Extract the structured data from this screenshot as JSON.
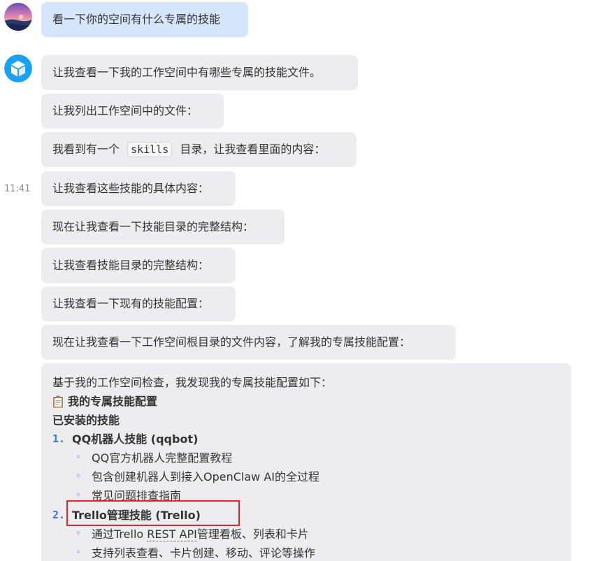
{
  "conversation": {
    "user_message": "看一下你的空间有什么专属的技能",
    "timestamp": "11:41",
    "bot_messages": [
      {
        "text": "让我查看一下我的工作空间中有哪些专属的技能文件。"
      },
      {
        "text": "让我列出工作空间中的文件："
      },
      {
        "before": "我看到有一个",
        "code": "skills",
        "after": "目录，让我查看里面的内容："
      },
      {
        "text": "让我查看这些技能的具体内容："
      },
      {
        "text": "现在让我查看一下技能目录的完整结构："
      },
      {
        "text": "让我查看技能目录的完整结构："
      },
      {
        "text": "让我查看一下现有的技能配置："
      },
      {
        "text": "现在让我查看一下工作空间根目录的文件内容，了解我的专属技能配置："
      }
    ],
    "final_message": {
      "intro": "基于我的工作空间检查，我发现我的专属技能配置如下：",
      "heading": "我的专属技能配置",
      "heading_icon": "clipboard-icon",
      "section": "已安装的技能",
      "skills": [
        {
          "num": "1.",
          "title": "QQ机器人技能 (qqbot)",
          "items": [
            "QQ官方机器人完整配置教程",
            "包含创建机器人到接入OpenClaw AI的全过程",
            "常见问题排查指南"
          ]
        },
        {
          "num": "2.",
          "title": "Trello管理技能 (Trello)",
          "items": [
            {
              "before": "通过Trello ",
              "underlined": "REST API",
              "after": "管理看板、列表和卡片"
            },
            "支持列表查看、卡片创建、移动、评论等操作"
          ]
        }
      ],
      "sub_bullet": "◦"
    }
  },
  "colors": {
    "user_bubble": "#d6e7fd",
    "bot_bubble": "#ededef",
    "list_marker": "#3b78d8",
    "highlight_box": "#e0252b"
  }
}
